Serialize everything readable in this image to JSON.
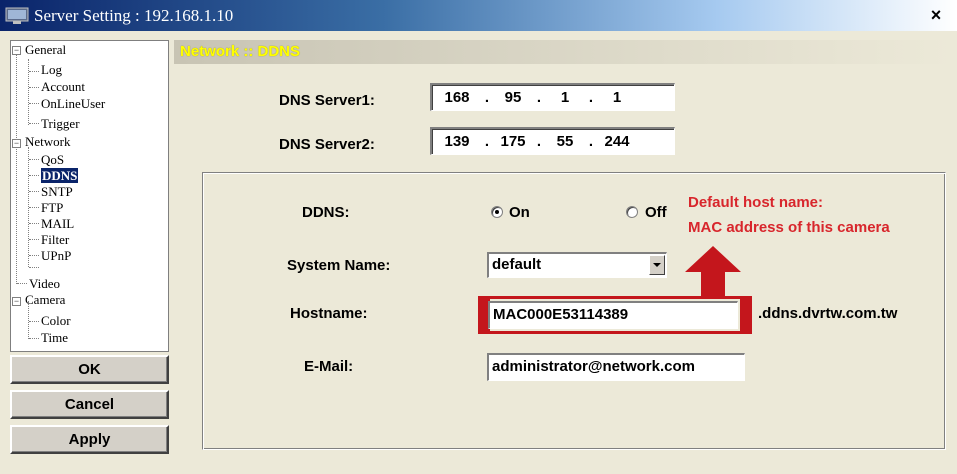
{
  "window": {
    "title": "Server Setting : 192.168.1.10",
    "close_label": "×",
    "app_icon": "monitor-icon"
  },
  "tree": {
    "general": "General",
    "log": "Log",
    "account": "Account",
    "online_user": "OnLineUser",
    "trigger": "Trigger",
    "network": "Network",
    "qos": "QoS",
    "ddns": "DDNS",
    "sntp": "SNTP",
    "ftp": "FTP",
    "mail": "MAIL",
    "filter": "Filter",
    "upnp": "UPnP",
    "video": "Video",
    "camera": "Camera",
    "color": "Color",
    "time": "Time",
    "expanded_symbol": "−",
    "selected": "DDNS"
  },
  "buttons": {
    "ok": "OK",
    "cancel": "Cancel",
    "apply": "Apply"
  },
  "main": {
    "header": "Network :: DDNS",
    "dns1_label": "DNS Server1:",
    "dns1": [
      "168",
      "95",
      "1",
      "1"
    ],
    "dns2_label": "DNS Server2:",
    "dns2": [
      "139",
      "175",
      "55",
      "244"
    ],
    "ip_dot": "."
  },
  "ddns": {
    "label": "DDNS:",
    "on_label": "On",
    "off_label": "Off",
    "selected": "On",
    "system_name_label": "System Name:",
    "system_name_value": "default",
    "hostname_label": "Hostname:",
    "hostname_value": "MAC000E53114389",
    "hostname_suffix": ".ddns.dvrtw.com.tw",
    "email_label": "E-Mail:",
    "email_value": "administrator@network.com"
  },
  "annotation": {
    "line1": "Default host name:",
    "line2": "MAC address of this camera",
    "color": "#d8262c"
  },
  "colors": {
    "header_text": "#ffff00",
    "selection": "#0a246a",
    "face": "#ece9d8"
  }
}
